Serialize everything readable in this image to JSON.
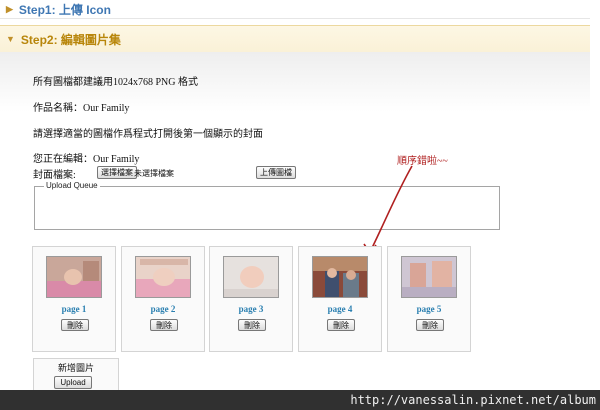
{
  "steps": [
    {
      "label": "Step1: 上傳 Icon",
      "expanded": false
    },
    {
      "label": "Step2: 編輯圖片集",
      "expanded": true
    }
  ],
  "panel": {
    "info_format": "所有圖檔都建議用1024x768 PNG 格式",
    "work_name": "作品名稱：Our Family",
    "instruction": "請選擇適當的圖檔作爲程式打開後第一個顯示的封面",
    "editing": "您正在編輯：Our Family",
    "cover_label": "封面檔案:",
    "choose_file": "選擇檔案",
    "no_file": "未選擇檔案",
    "upload_cover": "上傳圖檔",
    "queue_legend": "Upload Queue"
  },
  "annotation": "順序錯啦~~",
  "pages": [
    {
      "label": "page 1",
      "delete": "刪除"
    },
    {
      "label": "page 2",
      "delete": "刪除"
    },
    {
      "label": "page 3",
      "delete": "刪除"
    },
    {
      "label": "page 4",
      "delete": "刪除"
    },
    {
      "label": "page 5",
      "delete": "刪除"
    }
  ],
  "add": {
    "title": "新增圖片",
    "upload": "Upload"
  },
  "watermark_url": "http://vanessalin.pixnet.net/album",
  "colors": {
    "step_blue": "#3f77b3",
    "step_gold": "#b8860b",
    "page_label": "#2a7fb0",
    "annotation_red": "#b02020"
  }
}
